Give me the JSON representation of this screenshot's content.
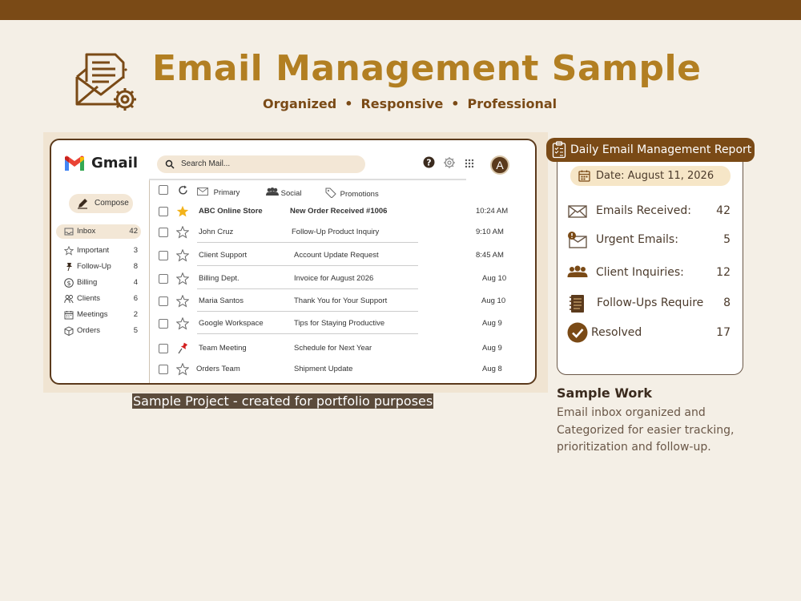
{
  "header": {
    "title": "Email Management Sample",
    "tagline": [
      "Organized",
      "Responsive",
      "Professional"
    ],
    "tagline_separator": "•"
  },
  "gmail": {
    "brand": "Gmail",
    "search_placeholder": "Search Mail...",
    "avatar_letter": "A",
    "compose_label": "Compose",
    "sidebar": [
      {
        "label": "Inbox",
        "count": "42",
        "icon": "inbox-icon",
        "active": true
      },
      {
        "label": "Important",
        "count": "3",
        "icon": "star-icon"
      },
      {
        "label": "Follow-Up",
        "count": "8",
        "icon": "pin-icon"
      },
      {
        "label": "Billing",
        "count": "4",
        "icon": "dollar-icon"
      },
      {
        "label": "Clients",
        "count": "6",
        "icon": "people-icon"
      },
      {
        "label": "Meetings",
        "count": "2",
        "icon": "calendar-icon"
      },
      {
        "label": "Orders",
        "count": "5",
        "icon": "box-icon"
      }
    ],
    "tabs": [
      {
        "label": "Primary",
        "icon": "envelope-icon"
      },
      {
        "label": "Social",
        "icon": "people-icon"
      },
      {
        "label": "Promotions",
        "icon": "tag-icon"
      }
    ],
    "emails": [
      {
        "sender": "ABC Online Store",
        "subject": "New Order Received #1006",
        "date": "10:24 AM",
        "mark": "star-filled",
        "unread": true
      },
      {
        "sender": "John Cruz",
        "subject": "Follow-Up Product Inquiry",
        "date": "9:10 AM",
        "mark": "star"
      },
      {
        "sender": "Client Support",
        "subject": "Account Update  Request",
        "date": "8:45 AM",
        "mark": "star"
      },
      {
        "sender": "Billing Dept.",
        "subject": "Invoice for August 2026",
        "date": "Aug 10",
        "mark": "star"
      },
      {
        "sender": "Maria Santos",
        "subject": "Thank You for Your Support",
        "date": "Aug 10",
        "mark": "star"
      },
      {
        "sender": "Google Workspace",
        "subject": "Tips for Staying Productive",
        "date": "Aug 9",
        "mark": "star"
      },
      {
        "sender": "Team Meeting",
        "subject": "Schedule for Next Year",
        "date": "Aug 9",
        "mark": "pin"
      },
      {
        "sender": "Orders Team",
        "subject": "Shipment Update",
        "date": "Aug 8",
        "mark": "star"
      }
    ]
  },
  "caption": "Sample Project - created for portfolio purposes",
  "report": {
    "title": "Daily Email Management Report",
    "date": "Date: August 11, 2026",
    "stats": [
      {
        "label": "Emails Received:",
        "value": "42",
        "icon": "envelope-icon"
      },
      {
        "label": "Urgent Emails:",
        "value": "5",
        "icon": "urgent-mail-icon"
      },
      {
        "label": "Client Inquiries:",
        "value": "12",
        "icon": "people-icon"
      },
      {
        "label": "Follow-Ups Require",
        "value": "8",
        "icon": "notebook-icon"
      },
      {
        "label": "Resolved",
        "value": "17",
        "icon": "check-circle-icon"
      }
    ]
  },
  "side": {
    "title": "Sample Work",
    "description": "Email inbox organized and Categorized for easier tracking, prioritization and follow-up."
  },
  "colors": {
    "brand_brown": "#7a4a16",
    "gold": "#b27f22",
    "beige": "#f4efe6",
    "highlight": "#f3e7d6"
  }
}
